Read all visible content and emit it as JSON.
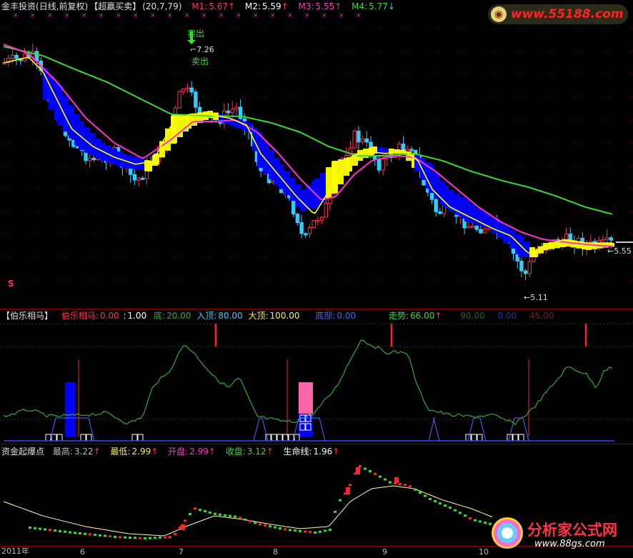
{
  "colors": {
    "bg": "#000000",
    "up": "#ff3355",
    "down": "#33ccff",
    "ma_yellow": "#ffff00",
    "ma_magenta": "#ff33cc",
    "ma_green": "#33dd33",
    "blue": "#0000ff",
    "yellow": "#ffff00",
    "pink": "#ff66aa"
  },
  "main": {
    "title_name": "金丰投资",
    "title_period": "(日线,前复权)",
    "title_indicator": "【超赢买卖】",
    "params": "(20,7,79)",
    "m1_label": "M1:",
    "m1_value": "5.67",
    "m2_label": "M2:",
    "m2_value": "5.59",
    "m3_label": "M3:",
    "m3_value": "5.55",
    "m4_label": "M4:",
    "m4_value": "5.77",
    "sell_label_1": "卖出",
    "sell_label_2": "卖出",
    "high_label": "7.26",
    "low_label": "5.11",
    "last_price_label": "5.55",
    "s_marker": "S"
  },
  "watermark_top": {
    "url": "www.55188.com"
  },
  "panel2": {
    "title": "【伯乐相马】",
    "f1_label": "伯乐相马:",
    "f1_value": "0.00",
    "f2_label": ":",
    "f2_value": "1.00",
    "f3_label": "底:",
    "f3_value": "20.00",
    "f4_label": "入顶:",
    "f4_value": "80.00",
    "f5_label": "大顶:",
    "f5_value": "100.00",
    "f6_label": "底部:",
    "f6_value": "0.00",
    "f7_label": "走势:",
    "f7_value": "66.00",
    "f8_value": "90.00",
    "f9_value": "0.00",
    "f10_value": "45.00"
  },
  "panel3": {
    "title": "资金起爆点",
    "f1_label": "最高:",
    "f1_value": "3.22",
    "f2_label": "最低:",
    "f2_value": "2.99",
    "f3_label": "开盘:",
    "f3_value": "2.99",
    "f4_label": "收盘:",
    "f4_value": "3.12",
    "f5_label": "生命线:",
    "f5_value": "1.96"
  },
  "xaxis": {
    "labels": [
      "2011年",
      "6",
      "7",
      "8",
      "9",
      "10"
    ]
  },
  "watermark_bottom": {
    "name": "分析家公式网",
    "url": "www.88gs.com"
  },
  "chart_data": [
    {
      "type": "candlestick",
      "title": "金丰投资(日线,前复权)",
      "series": [
        {
          "name": "M1",
          "last": 5.67
        },
        {
          "name": "M2",
          "last": 5.59
        },
        {
          "name": "M3",
          "last": 5.55
        },
        {
          "name": "M4",
          "last": 5.77
        }
      ],
      "annotations": [
        "卖出",
        "7.26",
        "5.11",
        "5.55"
      ],
      "ylim": [
        4.9,
        7.6
      ]
    },
    {
      "type": "line",
      "title": "伯乐相马",
      "ylim": [
        0,
        100
      ],
      "levels": [
        20,
        80,
        100
      ]
    },
    {
      "type": "line",
      "title": "资金起爆点",
      "series": [
        {
          "name": "生命线",
          "last": 1.96
        }
      ]
    }
  ]
}
